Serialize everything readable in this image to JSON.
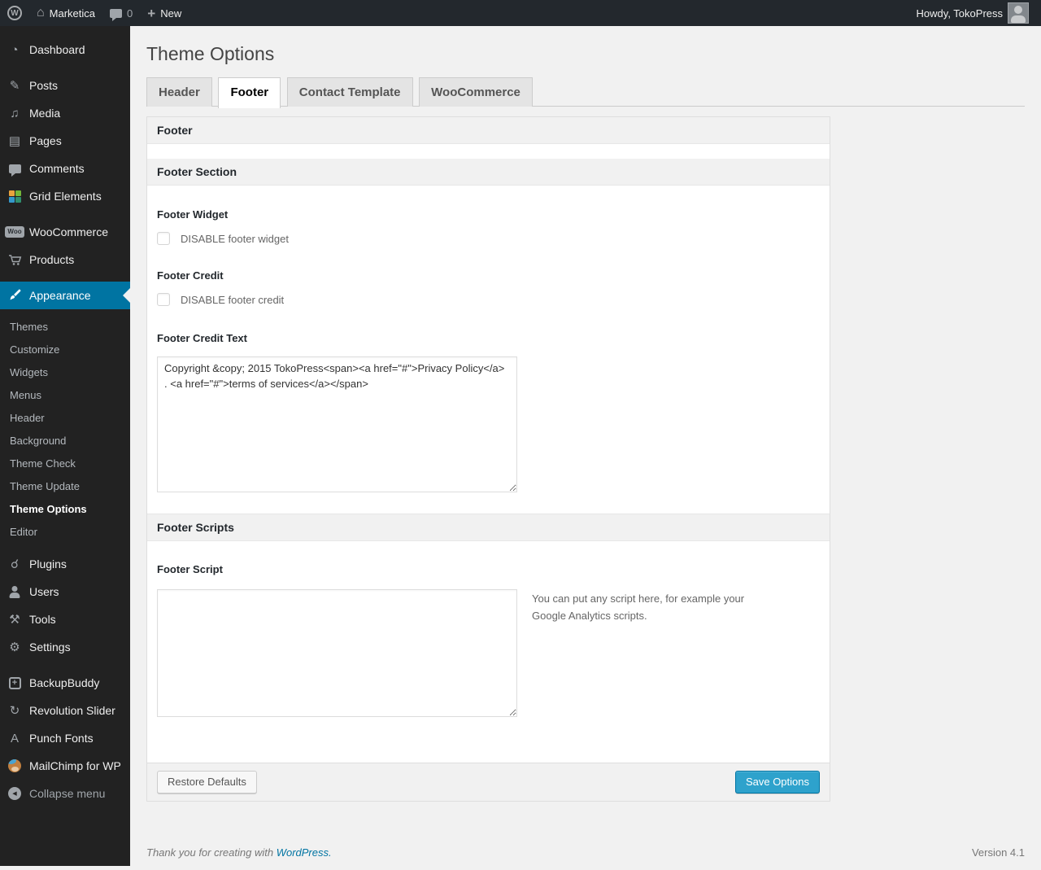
{
  "admin_bar": {
    "site_name": "Marketica",
    "comment_count": "0",
    "new_label": "New",
    "howdy": "Howdy, TokoPress"
  },
  "icons": {
    "wp_logo": "W",
    "home": "⌂",
    "new_plus": "+",
    "dashboard": "◔",
    "posts": "✎",
    "media": "♫",
    "pages": "▤",
    "plugins": "☌",
    "tools": "⚒",
    "settings": "⚙",
    "revolution_slider": "↻",
    "punch_fonts": "A",
    "woo_badge": "Woo",
    "collapse_arrow": "◀"
  },
  "sidebar": {
    "dashboard": "Dashboard",
    "posts": "Posts",
    "media": "Media",
    "pages": "Pages",
    "comments": "Comments",
    "grid_elements": "Grid Elements",
    "woocommerce": "WooCommerce",
    "products": "Products",
    "appearance": "Appearance",
    "submenu": {
      "themes": "Themes",
      "customize": "Customize",
      "widgets": "Widgets",
      "menus": "Menus",
      "header": "Header",
      "background": "Background",
      "theme_check": "Theme Check",
      "theme_update": "Theme Update",
      "theme_options": "Theme Options",
      "editor": "Editor"
    },
    "plugins": "Plugins",
    "users": "Users",
    "tools": "Tools",
    "settings": "Settings",
    "backupbuddy": "BackupBuddy",
    "revolution_slider": "Revolution Slider",
    "punch_fonts": "Punch Fonts",
    "mailchimp": "MailChimp for WP",
    "collapse": "Collapse menu"
  },
  "page": {
    "title": "Theme Options",
    "tabs": {
      "header": "Header",
      "footer": "Footer",
      "contact_template": "Contact Template",
      "woocommerce": "WooCommerce"
    }
  },
  "panel": {
    "group_title": "Footer",
    "section_title": "Footer Section",
    "fields": {
      "footer_widget_label": "Footer Widget",
      "footer_widget_checkbox": "DISABLE footer widget",
      "footer_credit_label": "Footer Credit",
      "footer_credit_checkbox": "DISABLE footer credit",
      "footer_credit_text_label": "Footer Credit Text",
      "footer_credit_text_value": "Copyright &copy; 2015 TokoPress<span><a href=\"#\">Privacy Policy</a> . <a href=\"#\">terms of services</a></span>",
      "scripts_section_title": "Footer Scripts",
      "footer_script_label": "Footer Script",
      "footer_script_value": "",
      "footer_script_help": "You can put any script here, for example your Google Analytics scripts."
    },
    "buttons": {
      "restore": "Restore Defaults",
      "save": "Save Options"
    }
  },
  "footer": {
    "thanks_prefix": "Thank you for creating with ",
    "wordpress_link": "WordPress.",
    "version": "Version 4.1"
  },
  "colors": {
    "admin_bar_bg": "#23282d",
    "menu_bg": "#222222",
    "highlight_blue": "#0074a2",
    "button_blue": "#2ea2cc",
    "body_bg": "#f1f1f1",
    "link_blue": "#0074a2"
  }
}
